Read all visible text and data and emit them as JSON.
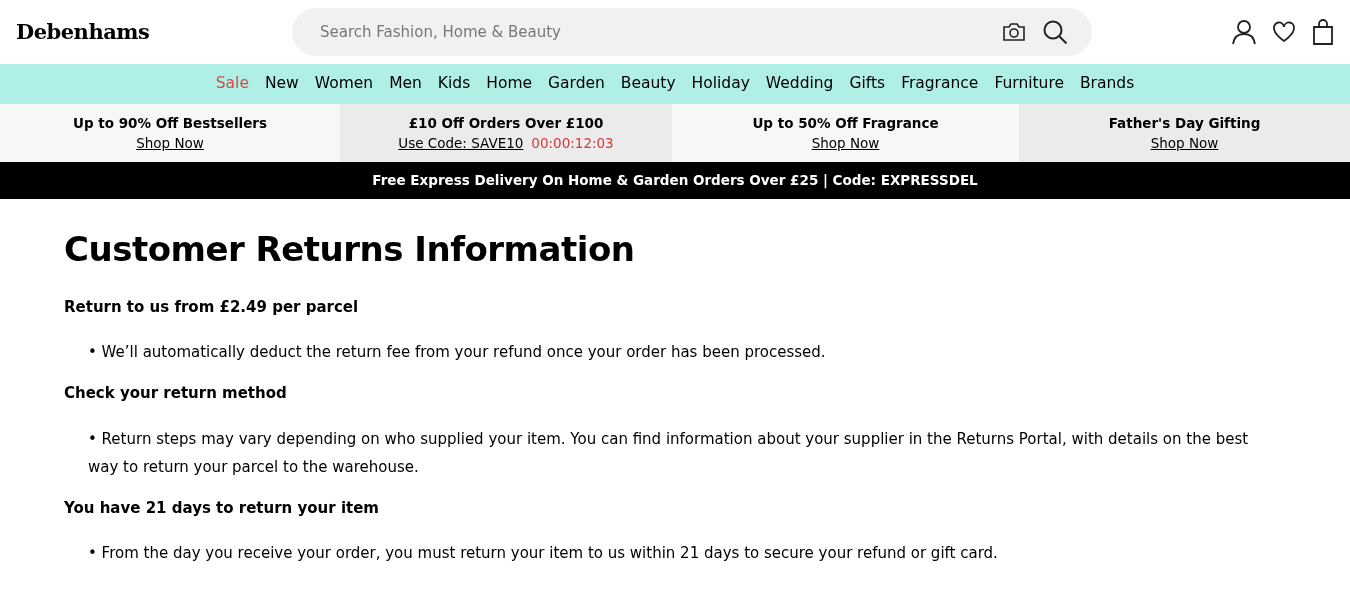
{
  "header": {
    "logo": "Debenhams",
    "search": {
      "placeholder": "Search Fashion, Home & Beauty"
    }
  },
  "nav": [
    {
      "label": "Sale",
      "kind": "sale"
    },
    {
      "label": "New",
      "kind": "regular"
    },
    {
      "label": "Women",
      "kind": "regular"
    },
    {
      "label": "Men",
      "kind": "regular"
    },
    {
      "label": "Kids",
      "kind": "regular"
    },
    {
      "label": "Home",
      "kind": "regular"
    },
    {
      "label": "Garden",
      "kind": "regular"
    },
    {
      "label": "Beauty",
      "kind": "regular"
    },
    {
      "label": "Holiday",
      "kind": "regular"
    },
    {
      "label": "Wedding",
      "kind": "regular"
    },
    {
      "label": "Gifts",
      "kind": "regular"
    },
    {
      "label": "Fragrance",
      "kind": "regular"
    },
    {
      "label": "Furniture",
      "kind": "regular"
    },
    {
      "label": "Brands",
      "kind": "regular"
    }
  ],
  "promos": [
    {
      "title": "Up to 90% Off Bestsellers",
      "link": "Shop Now"
    },
    {
      "title": "£10 Off Orders Over £100",
      "link": "Use Code: SAVE10",
      "countdown": "00:00:12:03"
    },
    {
      "title": "Up to 50% Off Fragrance",
      "link": "Shop Now"
    },
    {
      "title": "Father's Day Gifting",
      "link": "Shop Now"
    }
  ],
  "delivery_banner": "Free Express Delivery On Home & Garden Orders Over £25 | Code: EXPRESSDEL",
  "page_title": "Customer Returns Information",
  "sections": [
    {
      "heading": "Return to us from £2.49 per parcel",
      "bullets": [
        "• We’ll automatically deduct the return fee from your refund once your order has been processed."
      ]
    },
    {
      "heading": "Check your return method",
      "bullets": [
        "• Return steps may vary depending on who supplied your item. You can find information about your supplier in the Returns Portal, with details on the best way to return your parcel to the warehouse."
      ]
    },
    {
      "heading": "You have 21 days to return your item",
      "bullets": [
        "• From the day you receive your order, you must return your item to us within 21 days to secure your refund or gift card."
      ]
    }
  ]
}
